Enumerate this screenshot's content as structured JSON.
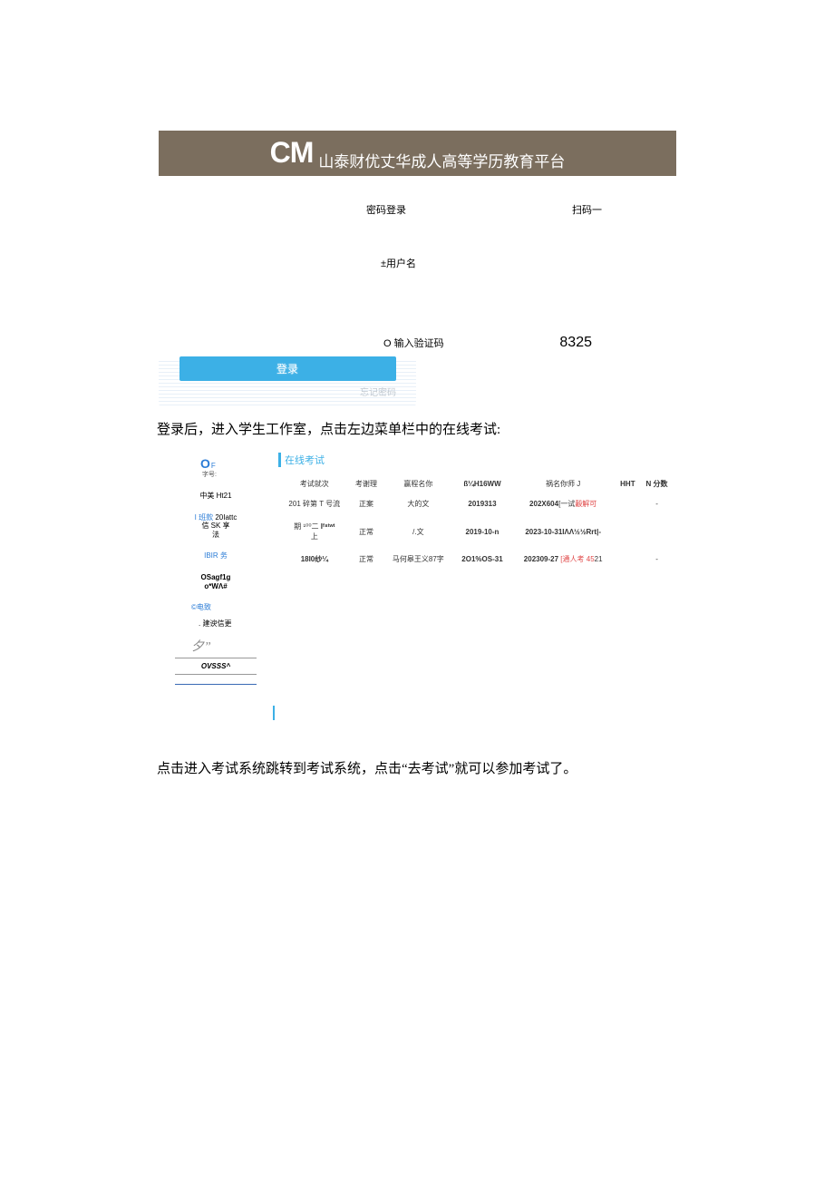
{
  "banner": {
    "logo": "CM",
    "title": "山泰财优丈华成人高等学历教育平台"
  },
  "login": {
    "tab_password": "密码登录",
    "tab_scan": "扫码一",
    "username_label": "±用户名",
    "captcha_icon": "O",
    "captcha_label": "输入验证码",
    "captcha_value": "8325",
    "button_label": "登录",
    "forgot_label": "忘记密码"
  },
  "instructions": {
    "step1": "登录后，进入学生工作室，点击左边菜单栏中的在线考试:",
    "step2": "点击进入考试系统跳转到考试系统，点击“去考试”就可以参加考试了。"
  },
  "workspace": {
    "sidebar": {
      "head_icon": "O",
      "head_suffix": "F",
      "sub_label": "字号:",
      "items": [
        {
          "text": "中美 Ht21",
          "blue": false
        },
        {
          "text": "I 班款 20Iattc\n信 SK 享\n法",
          "blue_prefix": "I 班款"
        },
        {
          "text": "IBIR 务",
          "blue": true
        },
        {
          "text": "OSagf1g\no*WΛ#",
          "blue": false
        },
        {
          "text": "©电致",
          "blue": true
        },
        {
          "text": ". 建谀信更",
          "blue": false
        },
        {
          "text": "夕”",
          "italic": true
        },
        {
          "text": "OVSSS^",
          "bottom": true
        }
      ]
    },
    "main_title": "在线考试",
    "table": {
      "headers": [
        "考试就次",
        "考谢理",
        "赢程名你",
        "ß¼H16WW",
        "祸名你师 J",
        "HHT",
        "N 分数"
      ],
      "rows": [
        [
          "201 碎第 T 号流",
          "正案",
          "大的文",
          "2019313",
          "202X604[一试觳解可",
          "",
          "-"
        ],
        [
          "期 ¹⁰⁰二 Iᶠ⁸ᵗʷᵗ\n上",
          "正常",
          "/.文",
          "2019-10-n",
          "2023-10-31IΛΛ½½Rrt|-",
          "",
          ""
        ],
        [
          "18I0纱¼",
          "正常",
          "马何皋王义87字",
          "2O1%OS-31",
          "202309-27 [通人考 4521",
          "",
          "-"
        ]
      ]
    }
  }
}
